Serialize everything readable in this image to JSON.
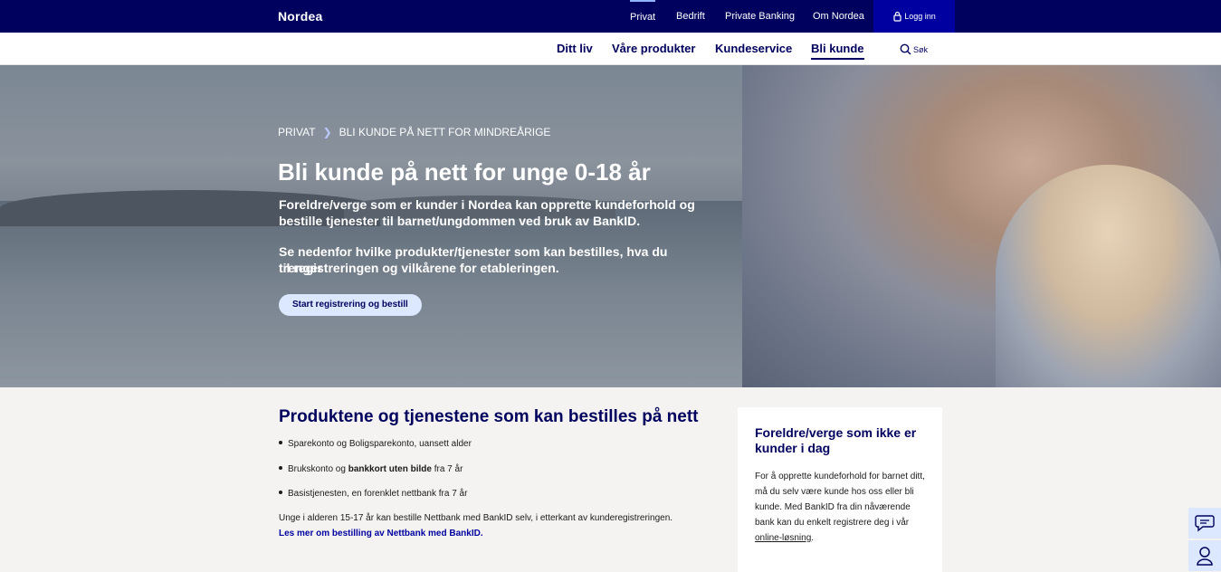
{
  "brand": {
    "logo": "Nordea"
  },
  "top_nav": {
    "items": [
      {
        "label": "Privat",
        "active": true
      },
      {
        "label": "Bedrift",
        "active": false
      },
      {
        "label": "Private Banking",
        "active": false
      },
      {
        "label": "Om Nordea",
        "active": false
      }
    ],
    "login_label": "Logg inn"
  },
  "sub_nav": {
    "items": [
      {
        "label": "Ditt liv",
        "active": false
      },
      {
        "label": "Våre produkter",
        "active": false
      },
      {
        "label": "Kundeservice",
        "active": false
      },
      {
        "label": "Bli kunde",
        "active": true
      }
    ],
    "search_label": "Søk"
  },
  "hero": {
    "breadcrumb": [
      "PRIVAT",
      "BLI KUNDE PÅ NETT FOR MINDREÅRIGE"
    ],
    "title": "Bli kunde på nett for unge 0-18 år",
    "paragraph_1a": "Foreldre/verge som er kunder i Nordea kan opprette kundeforhold og",
    "paragraph_1b": "bestille tjenester til barnet/ungdommen ved bruk av BankID.",
    "paragraph_2a": "Se nedenfor hvilke produkter/tjenester som kan bestilles, hva du trenger",
    "paragraph_2b": "til registreringen og vilkårene for etableringen.",
    "cta_label": "Start registrering og bestill"
  },
  "products": {
    "title": "Produktene og tjenestene som kan bestilles på nett",
    "item_1": "Sparekonto og Boligsparekonto, uansett alder",
    "item_2_pre": "Brukskonto og ",
    "item_2_bold": "bankkort uten bilde",
    "item_2_post": " fra 7 år",
    "item_3": "Basistjenesten, en forenklet nettbank fra 7 år",
    "note": "Unge i alderen 15-17 år kan bestille Nettbank med BankID selv, i etterkant av kunderegistreringen.",
    "link": "Les mer om bestilling av Nettbank med BankID."
  },
  "card": {
    "title": "Foreldre/verge som ikke er kunder i dag",
    "text": "For å opprette kundeforhold for barnet ditt, må du selv være kunde hos oss eller bli kunde. Med BankID fra din nåværende bank kan du enkelt registrere deg i vår ",
    "link": "online-løsning",
    "text_end": "."
  },
  "colors": {
    "navy": "#00005e",
    "accent": "#0000a0",
    "light_blue": "#dce8ff"
  }
}
